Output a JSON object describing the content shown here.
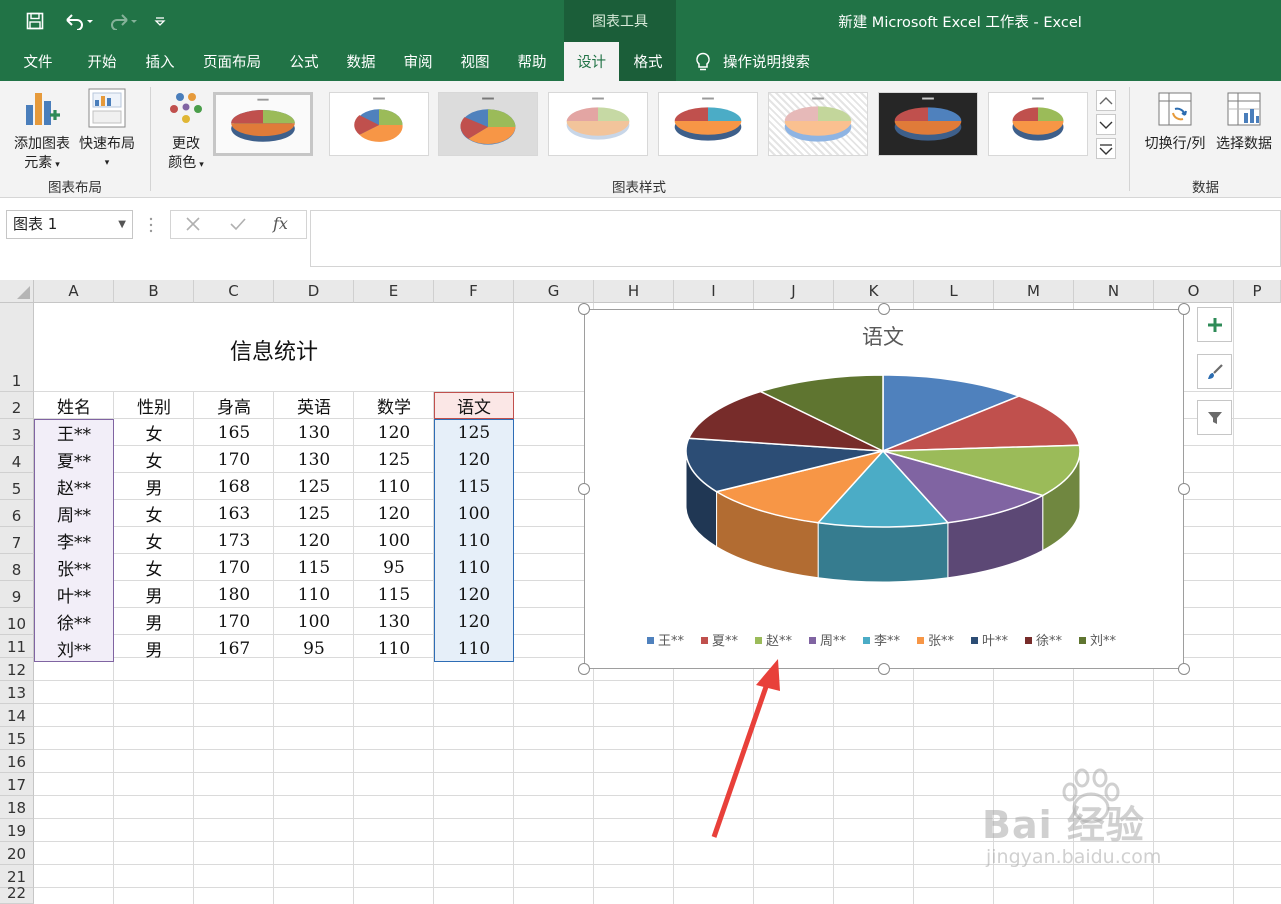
{
  "window": {
    "title": "新建 Microsoft Excel 工作表  -  Excel",
    "contextual_tab_group": "图表工具"
  },
  "tabs": [
    {
      "label": "文件",
      "active": false
    },
    {
      "label": "开始",
      "active": false
    },
    {
      "label": "插入",
      "active": false
    },
    {
      "label": "页面布局",
      "active": false
    },
    {
      "label": "公式",
      "active": false
    },
    {
      "label": "数据",
      "active": false
    },
    {
      "label": "审阅",
      "active": false
    },
    {
      "label": "视图",
      "active": false
    },
    {
      "label": "帮助",
      "active": false
    },
    {
      "label": "设计",
      "active": true
    },
    {
      "label": "格式",
      "active": false
    }
  ],
  "tell_me": "操作说明搜索",
  "ribbon": {
    "add_element": {
      "line1": "添加图表",
      "line2": "元素"
    },
    "quick_layout": {
      "line1": "快速布局"
    },
    "change_colors": {
      "line1": "更改",
      "line2": "颜色"
    },
    "switch_row_col": "切换行/列",
    "select_data": "选择数据",
    "groups": {
      "layout": "图表布局",
      "styles": "图表样式",
      "data": "数据"
    }
  },
  "formula_bar": {
    "name_box": "图表 1",
    "fx": "fx",
    "formula": ""
  },
  "sheet": {
    "columns": [
      "A",
      "B",
      "C",
      "D",
      "E",
      "F",
      "G",
      "H",
      "I",
      "J",
      "K",
      "L",
      "M",
      "N",
      "O",
      "P"
    ],
    "rows": [
      "1",
      "2",
      "3",
      "4",
      "5",
      "6",
      "7",
      "8",
      "9",
      "10",
      "11",
      "12",
      "13",
      "14",
      "15",
      "16",
      "17",
      "18",
      "19",
      "20",
      "21",
      "22"
    ],
    "title": "信息统计",
    "headers": [
      "姓名",
      "性别",
      "身高",
      "英语",
      "数学",
      "语文"
    ],
    "data": [
      [
        "王**",
        "女",
        "165",
        "130",
        "120",
        "125"
      ],
      [
        "夏**",
        "女",
        "170",
        "130",
        "125",
        "120"
      ],
      [
        "赵**",
        "男",
        "168",
        "125",
        "110",
        "115"
      ],
      [
        "周**",
        "女",
        "163",
        "125",
        "120",
        "100"
      ],
      [
        "李**",
        "女",
        "173",
        "120",
        "100",
        "110"
      ],
      [
        "张**",
        "女",
        "170",
        "115",
        "95",
        "110"
      ],
      [
        "叶**",
        "男",
        "180",
        "110",
        "115",
        "120"
      ],
      [
        "徐**",
        "男",
        "170",
        "100",
        "130",
        "120"
      ],
      [
        "刘**",
        "男",
        "167",
        "95",
        "110",
        "110"
      ]
    ]
  },
  "chart_data": {
    "type": "pie",
    "title": "语文",
    "categories": [
      "王**",
      "夏**",
      "赵**",
      "周**",
      "李**",
      "张**",
      "叶**",
      "徐**",
      "刘**"
    ],
    "values": [
      125,
      120,
      115,
      100,
      110,
      110,
      120,
      120,
      110
    ],
    "colors": [
      "#4f81bd",
      "#c0504d",
      "#9bbb59",
      "#8064a2",
      "#4bacc6",
      "#f79646",
      "#2c4d75",
      "#772c2a",
      "#5f7530"
    ],
    "legend_position": "bottom",
    "style": "3d"
  },
  "watermark": {
    "line1": "Bai 经验",
    "line2": "jingyan.baidu.com"
  }
}
